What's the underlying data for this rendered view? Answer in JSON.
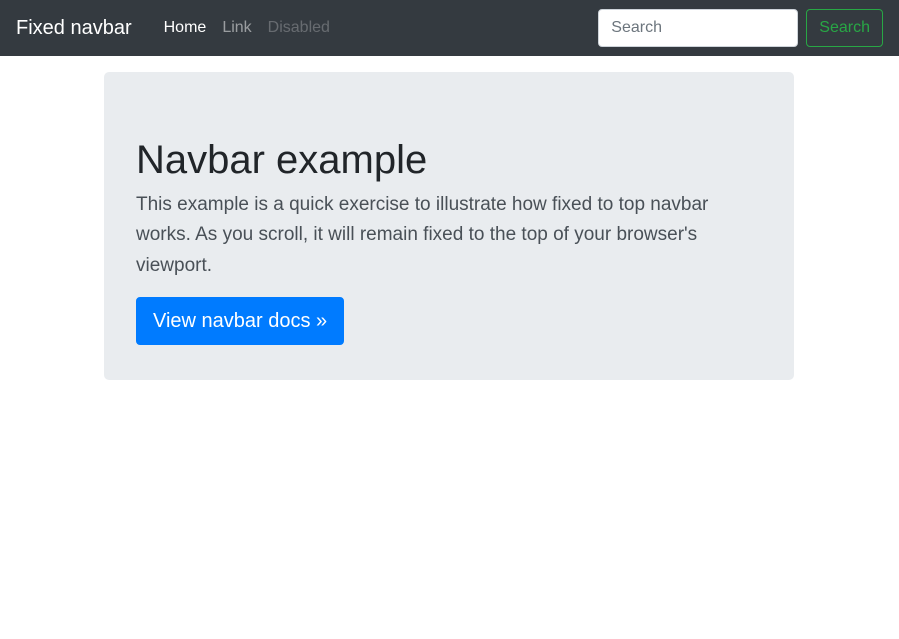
{
  "navbar": {
    "brand": "Fixed navbar",
    "links": [
      {
        "label": "Home",
        "state": "active"
      },
      {
        "label": "Link",
        "state": "normal"
      },
      {
        "label": "Disabled",
        "state": "disabled"
      }
    ],
    "search": {
      "placeholder": "Search",
      "value": "",
      "button_label": "Search"
    }
  },
  "jumbotron": {
    "heading": "Navbar example",
    "lead": "This example is a quick exercise to illustrate how fixed to top navbar works. As you scroll, it will remain fixed to the top of your browser's viewport.",
    "button_label": "View navbar docs »"
  },
  "colors": {
    "navbar_bg": "#343a40",
    "jumbotron_bg": "#e9ecef",
    "primary": "#007bff",
    "success": "#28a745"
  }
}
